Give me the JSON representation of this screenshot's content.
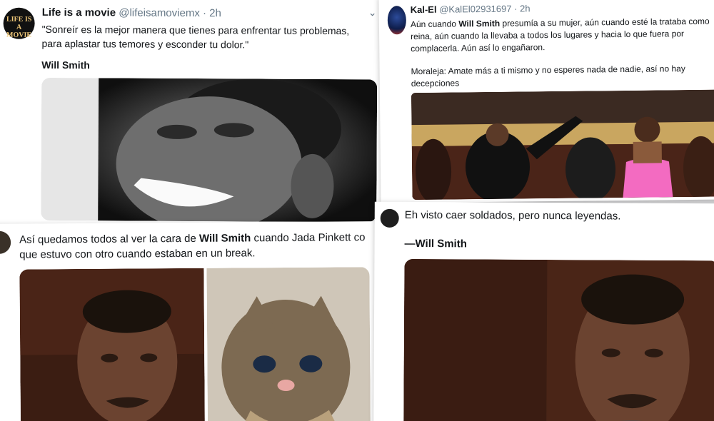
{
  "tweets": [
    {
      "display_name": "Life is a movie",
      "handle": "@lifeisamoviemx",
      "time": "· 2h",
      "avatar_text": "LIFE IS A MOVIE",
      "text": "\"Sonreír es la mejor manera que tienes para enfrentar tus problemas, para aplastar tus temores y esconder tu dolor.\"",
      "signature": "Will Smith",
      "media_caption": "",
      "menu_icon": "chevron-down-icon"
    },
    {
      "display_name": "Kal-El",
      "handle": "@KalEl02931697",
      "time": "· 2h",
      "text_before": "Aún cuando ",
      "text_bold": "Will Smith",
      "text_after": " presumía a su mujer, aún cuando esté la trataba como reina, aún cuando la llevaba a todos los lugares y hacia lo que fuera por complacerla. Aún así lo engañaron.",
      "moral": "Moraleja: Amate más a ti mismo y no esperes nada de nadie, así no hay decepciones"
    },
    {
      "text_before": "Así quedamos todos al ver la cara de ",
      "text_bold": "Will Smith",
      "text_after": " cuando Jada Pinkett co",
      "text_line2": "que estuvo con otro cuando estaban en un break."
    },
    {
      "text": "Eh visto caer soldados, pero nunca leyendas.",
      "signature": "—Will Smith"
    }
  ],
  "colors": {
    "text": "#14171a",
    "muted": "#657786",
    "card": "#ffffff"
  }
}
